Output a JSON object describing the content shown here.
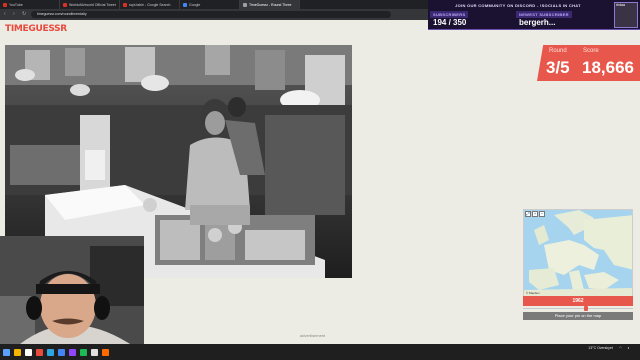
{
  "browser": {
    "tabs": [
      {
        "label": "YouTube",
        "active": false,
        "fav": "red"
      },
      {
        "label": "WorldofArtworld Official Tweet",
        "active": false,
        "fav": "red"
      },
      {
        "label": "scpt.table - Google Search",
        "active": false,
        "fav": "red"
      },
      {
        "label": "Google",
        "active": false,
        "fav": "blue"
      },
      {
        "label": "TimeGuessr - Round Three",
        "active": true,
        "fav": "gray"
      }
    ],
    "url": "timeguessr.com/roundthreedaily"
  },
  "page": {
    "logo": "TIMEGUESSR",
    "round_label": "Round",
    "round_value": "3/5",
    "score_label": "Score",
    "score_value": "18,666",
    "map_attribution": "© Mapbox",
    "year": "1962",
    "year_fraction": 0.58,
    "place_pin_label": "Place your pin on the map",
    "advertisement": "advertisement"
  },
  "stream_overlay": {
    "banner": "JOIN OUR COMMUNITY ON DISCORD - !SOCIALS IN CHAT",
    "subscribers_label": "SUBSCRIBERS",
    "subscribers_value": "194 / 350",
    "newest_label": "NEWEST SUBSCRIBER",
    "newest_value": "bergerh...",
    "cam_tag": "rhdaa"
  },
  "taskbar": {
    "weather": "13°C Overskyet",
    "time": "",
    "date": "",
    "icons": [
      "#5aa0ff",
      "#f4b400",
      "#ffffff",
      "#e84a3c",
      "#2ca5e0",
      "#4285f4",
      "#9146ff",
      "#1db954",
      "#e0e0e0",
      "#ff6b00"
    ]
  },
  "colors": {
    "accent": "#e8574b",
    "page_bg": "#ecebe4",
    "overlay_bg": "#1a1230"
  }
}
